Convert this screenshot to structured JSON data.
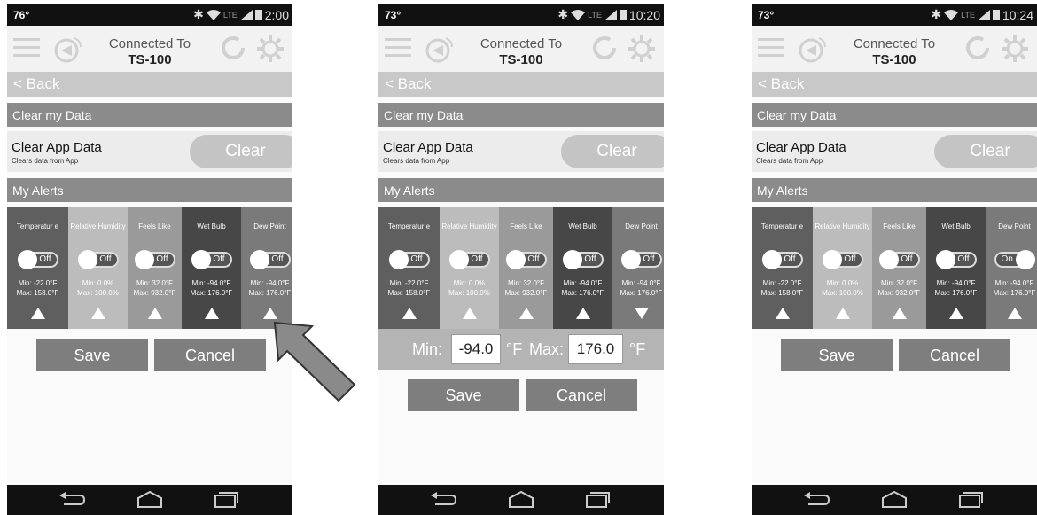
{
  "phones": [
    {
      "status": {
        "temp": "76°",
        "time": "2:00"
      },
      "header": {
        "connected_label": "Connected To",
        "device": "TS-100"
      },
      "back_label": "< Back",
      "clear_section": "Clear my Data",
      "clear_title": "Clear App Data",
      "clear_sub": "Clears data from App",
      "clear_btn": "Clear",
      "alerts_section": "My Alerts",
      "alerts": [
        {
          "name": "Temperatur e",
          "toggle": "Off",
          "min": "Min: -22.0°F",
          "max": "Max: 158.0°F",
          "arrow": "up",
          "color": "#5f5f5f"
        },
        {
          "name": "Relative Humidity",
          "toggle": "Off",
          "min": "Min: 0.0%",
          "max": "Max: 100.0%",
          "arrow": "up",
          "color": "#bcbcbc"
        },
        {
          "name": "Feels Like",
          "toggle": "Off",
          "min": "Min: 32.0°F",
          "max": "Max: 932.0°F",
          "arrow": "up",
          "color": "#9a9a9a"
        },
        {
          "name": "Wet Bulb",
          "toggle": "Off",
          "min": "Min: -94.0°F",
          "max": "Max: 176.0°F",
          "arrow": "up",
          "color": "#474747"
        },
        {
          "name": "Dew Point",
          "toggle": "Off",
          "min": "Min: -94.0°F",
          "max": "Max: 176.0°F",
          "arrow": "up",
          "color": "#7a7a7a"
        }
      ],
      "minmax": null,
      "save": "Save",
      "cancel": "Cancel"
    },
    {
      "status": {
        "temp": "73°",
        "time": "10:20"
      },
      "header": {
        "connected_label": "Connected To",
        "device": "TS-100"
      },
      "back_label": "< Back",
      "clear_section": "Clear my Data",
      "clear_title": "Clear App Data",
      "clear_sub": "Clears data from App",
      "clear_btn": "Clear",
      "alerts_section": "My Alerts",
      "alerts": [
        {
          "name": "Temperatur e",
          "toggle": "Off",
          "min": "Min: -22.0°F",
          "max": "Max: 158.0°F",
          "arrow": "up",
          "color": "#5f5f5f"
        },
        {
          "name": "Relative Humidity",
          "toggle": "Off",
          "min": "Min: 0.0%",
          "max": "Max: 100.0%",
          "arrow": "up",
          "color": "#bcbcbc"
        },
        {
          "name": "Feels Like",
          "toggle": "Off",
          "min": "Min: 32.0°F",
          "max": "Max: 932.0°F",
          "arrow": "up",
          "color": "#9a9a9a"
        },
        {
          "name": "Wet Bulb",
          "toggle": "Off",
          "min": "Min: -94.0°F",
          "max": "Max: 176.0°F",
          "arrow": "up",
          "color": "#474747"
        },
        {
          "name": "Dew Point",
          "toggle": "Off",
          "min": "Min: -94.0°F",
          "max": "Max: 176.0°F",
          "arrow": "down",
          "color": "#7a7a7a"
        }
      ],
      "minmax": {
        "min_label": "Min:",
        "min_value": "-94.0",
        "unit": "°F",
        "max_label": "Max:",
        "max_value": "176.0"
      },
      "save": "Save",
      "cancel": "Cancel"
    },
    {
      "status": {
        "temp": "73°",
        "time": "10:24"
      },
      "header": {
        "connected_label": "Connected To",
        "device": "TS-100"
      },
      "back_label": "< Back",
      "clear_section": "Clear my Data",
      "clear_title": "Clear App Data",
      "clear_sub": "Clears data from App",
      "clear_btn": "Clear",
      "alerts_section": "My Alerts",
      "alerts": [
        {
          "name": "Temperatur e",
          "toggle": "Off",
          "min": "Min: -22.0°F",
          "max": "Max: 158.0°F",
          "arrow": "up",
          "color": "#5f5f5f"
        },
        {
          "name": "Relative Humidity",
          "toggle": "Off",
          "min": "Min: 0.0%",
          "max": "Max: 100.0%",
          "arrow": "up",
          "color": "#bcbcbc"
        },
        {
          "name": "Feels Like",
          "toggle": "Off",
          "min": "Min: 32.0°F",
          "max": "Max: 932.0°F",
          "arrow": "up",
          "color": "#9a9a9a"
        },
        {
          "name": "Wet Bulb",
          "toggle": "Off",
          "min": "Min: -94.0°F",
          "max": "Max: 176.0°F",
          "arrow": "up",
          "color": "#474747"
        },
        {
          "name": "Dew Point",
          "toggle": "On",
          "min": "Min: -94.0°F",
          "max": "Max: 176.0°F",
          "arrow": "up",
          "color": "#7a7a7a"
        }
      ],
      "minmax": null,
      "save": "Save",
      "cancel": "Cancel"
    }
  ],
  "icons": {
    "callout": "arrow-callout-icon",
    "menu": "hamburger-icon",
    "satellite": "satellite-icon",
    "refresh": "refresh-icon",
    "settings": "gear-icon"
  }
}
